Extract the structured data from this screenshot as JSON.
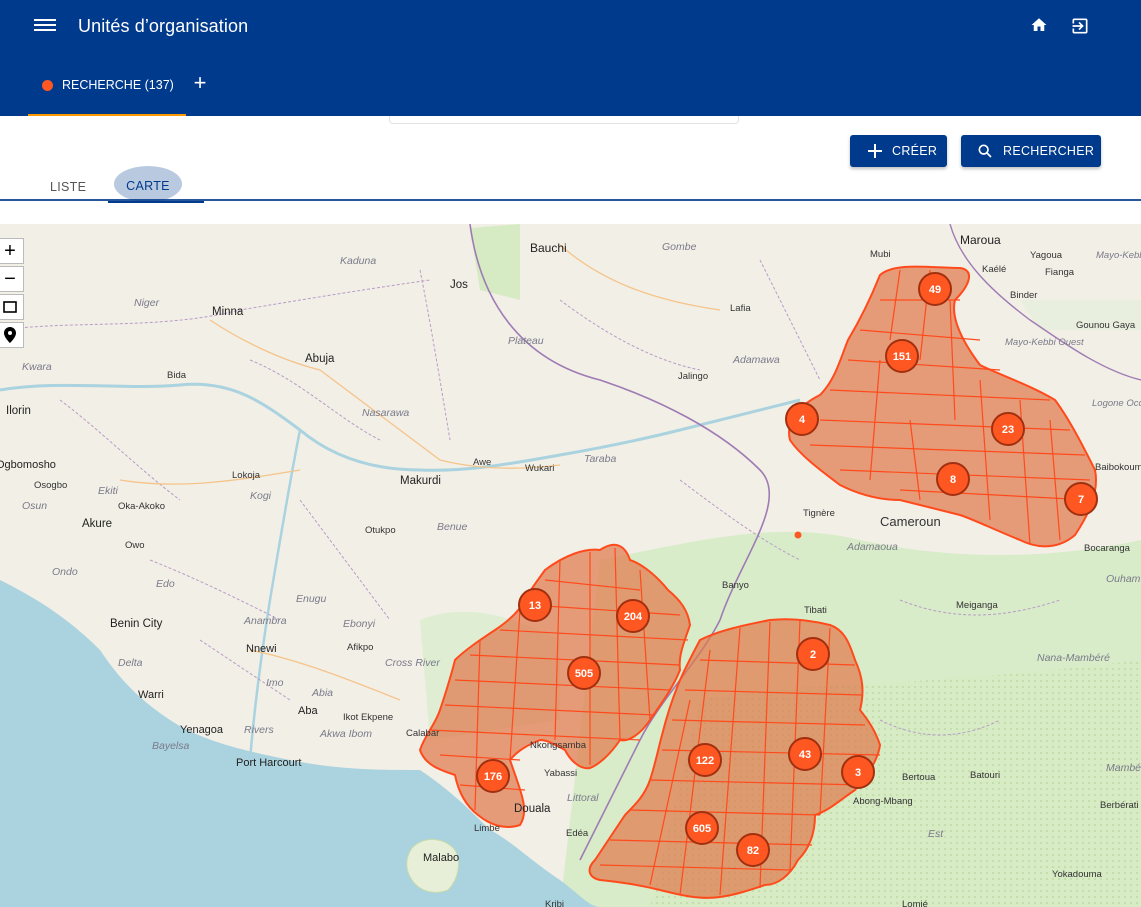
{
  "header": {
    "title": "Unités d’organisation"
  },
  "tabs": {
    "active_label": "RECHERCHE (137)",
    "add_label": "+"
  },
  "actions": {
    "create_label": "CRÉER",
    "search_label": "RECHERCHER"
  },
  "view_tabs": {
    "list_label": "LISTE",
    "map_label": "CARTE"
  },
  "map": {
    "controls": [
      "zoom-in",
      "zoom-out",
      "draw-rectangle",
      "locate"
    ],
    "place_labels": [
      "Bauchi",
      "Gombe",
      "Maroua",
      "Yagoua",
      "Mayo-Kebbi Est",
      "Kaélé",
      "Fianga",
      "Binder",
      "Gounou Gaya",
      "Mubi",
      "Kaduna",
      "Jos",
      "Niger",
      "Minna",
      "Lafia",
      "Plateau",
      "Abuja",
      "Kwara",
      "Bida",
      "Adamawa",
      "Jalingo",
      "Mayo-Kebbi Ouest",
      "Logone Occidental",
      "Ilorin",
      "Nasarawa",
      "Taraba",
      "Ogbomosho",
      "Osogbo",
      "Ekiti",
      "Osun",
      "Lokoja",
      "Kogi",
      "Awe",
      "Wukari",
      "Makurdi",
      "Oka-Akoko",
      "Akure",
      "Owo",
      "Otukpo",
      "Benue",
      "Tignère",
      "Cameroun",
      "Adamaoua",
      "Baibokoum",
      "Bocaranga",
      "Ouham",
      "Ondo",
      "Edo",
      "Enugu",
      "Banyo",
      "Tibati",
      "Meiganga",
      "Benin City",
      "Anambra",
      "Ebonyi",
      "Nnewi",
      "Afikpo",
      "Cross River",
      "Delta",
      "Imo",
      "Abia",
      "Warri",
      "Aba",
      "Ikot Ekpene",
      "Calabar",
      "Akwa Ibom",
      "Yenagoa",
      "Rivers",
      "Bayelsa",
      "Port Harcourt",
      "Nkongsamba",
      "Yabassi",
      "Littoral",
      "Douala",
      "Edéa",
      "Limbe",
      "Malabo",
      "Bertoua",
      "Batouri",
      "Abong-Mbang",
      "Est",
      "Berbérati",
      "Nana-Mambéré",
      "Mambéré-Kadéï",
      "Yokadouma",
      "Lomié",
      "Kribi"
    ],
    "clusters": [
      {
        "count": 49
      },
      {
        "count": 151
      },
      {
        "count": 4
      },
      {
        "count": 23
      },
      {
        "count": 8
      },
      {
        "count": 7
      },
      {
        "count": 13
      },
      {
        "count": 204
      },
      {
        "count": 505
      },
      {
        "count": 2
      },
      {
        "count": 176
      },
      {
        "count": 122
      },
      {
        "count": 43
      },
      {
        "count": 3
      },
      {
        "count": 605
      },
      {
        "count": 82
      }
    ],
    "colors": {
      "polygon_fill": "#e07a4e",
      "polygon_stroke": "#ff4a1c",
      "cluster_fill": "#ff5722",
      "cluster_ring": "#a03010",
      "water": "#aad3df",
      "land": "#f2efe6",
      "forest": "#cde6b8"
    }
  }
}
